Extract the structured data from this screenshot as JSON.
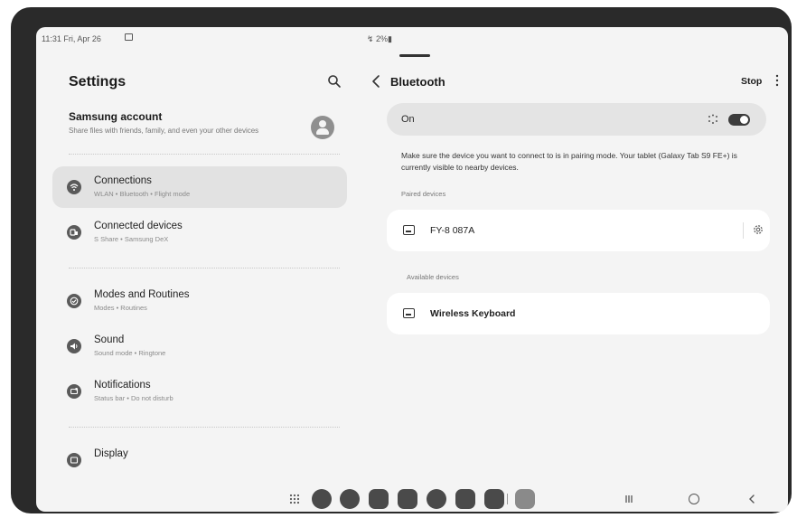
{
  "status_bar": {
    "time": "11:31  Fri, Apr 26",
    "right": "↯ 2%▮"
  },
  "settings": {
    "title": "Settings",
    "account": {
      "name": "Samsung account",
      "description": "Share files with friends, family, and even your other devices"
    },
    "items": [
      {
        "label": "Connections",
        "sub": "WLAN • Bluetooth • Flight mode",
        "icon": "wifi-icon",
        "selected": true
      },
      {
        "label": "Connected devices",
        "sub": "S Share • Samsung DeX",
        "icon": "connected-devices-icon",
        "selected": false
      },
      {
        "label": "Modes and Routines",
        "sub": "Modes • Routines",
        "icon": "check-circle-icon",
        "selected": false
      },
      {
        "label": "Sound",
        "sub": "Sound mode • Ringtone",
        "icon": "speaker-icon",
        "selected": false
      },
      {
        "label": "Notifications",
        "sub": "Status bar • Do not disturb",
        "icon": "bell-icon",
        "selected": false
      },
      {
        "label": "Display",
        "sub": "",
        "icon": "display-icon",
        "selected": false
      }
    ]
  },
  "bluetooth": {
    "title": "Bluetooth",
    "stop_label": "Stop",
    "toggle_label": "On",
    "toggle_on": true,
    "info": "Make sure the device you want to connect to is in pairing mode. Your tablet (Galaxy Tab S9 FE+) is currently visible to nearby devices.",
    "paired_label": "Paired devices",
    "paired_devices": [
      {
        "name": "FY-8 087A"
      }
    ],
    "available_label": "Available devices",
    "available_devices": [
      {
        "name": "Wireless Keyboard"
      }
    ]
  },
  "colors": {
    "accent": "#3c3c3c",
    "selected_row": "#e2e2e2",
    "card": "#ffffff"
  }
}
